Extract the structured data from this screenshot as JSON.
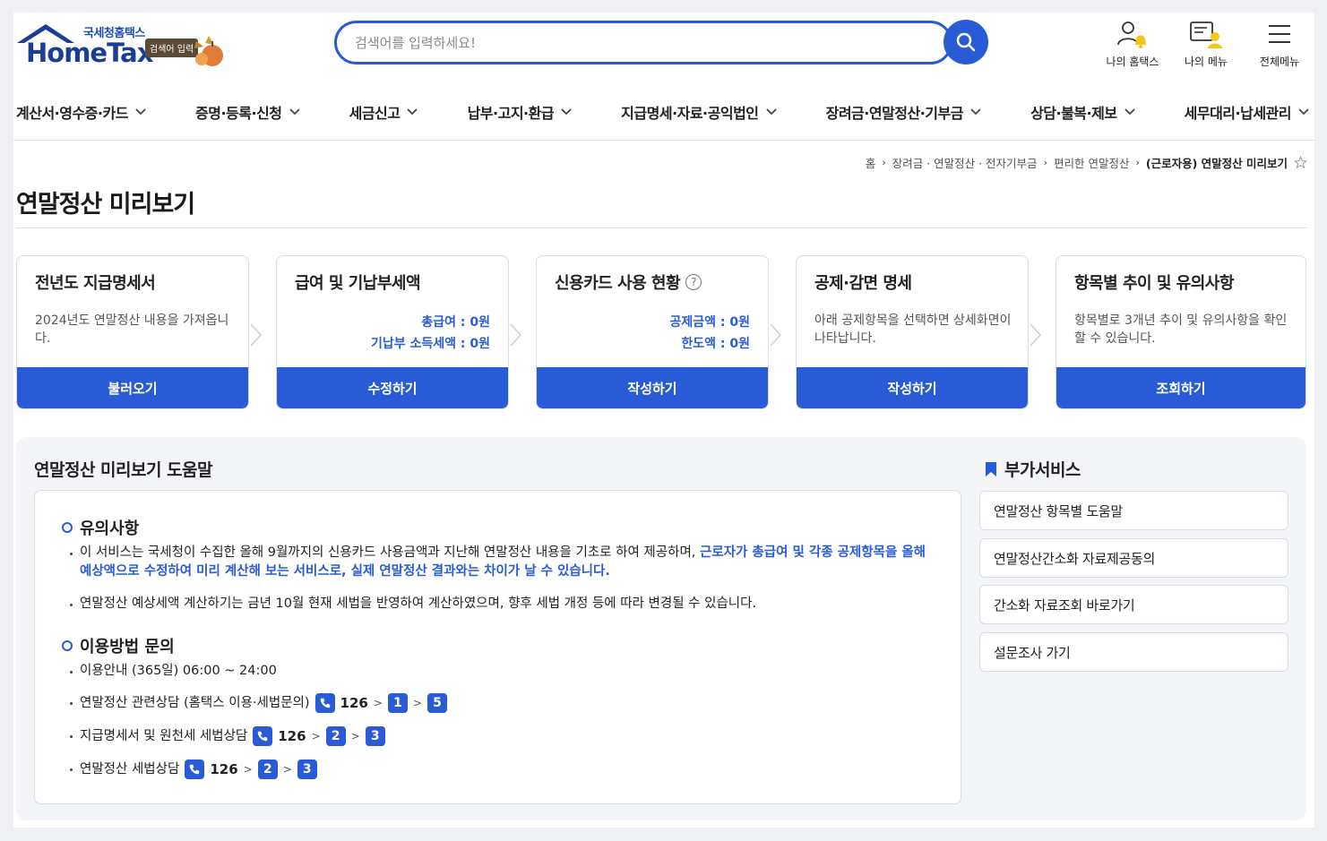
{
  "header": {
    "logo_sub": "국세청홈택스",
    "logo_main": "HomeTax",
    "logo_badge": "검색어 입력",
    "search_placeholder": "검색어를 입력하세요!",
    "links": [
      {
        "label": "나의 홈택스",
        "icon": "user-bell-icon"
      },
      {
        "label": "나의 메뉴",
        "icon": "my-menu-icon"
      },
      {
        "label": "전체메뉴",
        "icon": "hamburger-icon"
      }
    ]
  },
  "gnb": [
    "계산서·영수증·카드",
    "증명·등록·신청",
    "세금신고",
    "납부·고지·환급",
    "지급명세·자료·공익법인",
    "장려금·연말정산·기부금",
    "상담·불복·제보",
    "세무대리·납세관리"
  ],
  "breadcrumb": {
    "home": "홈",
    "items": [
      "장려금 · 연말정산 · 전자기부금",
      "편리한 연말정산"
    ],
    "current": "(근로자용) 연말정산 미리보기"
  },
  "page_title": "연말정산 미리보기",
  "cards": [
    {
      "title": "전년도 지급명세서",
      "desc": "2024년도 연말정산 내용을 가져옵니다.",
      "button": "불러오기"
    },
    {
      "title": "급여 및 기납부세액",
      "values": [
        "총급여 : 0원",
        "기납부 소득세액 : 0원"
      ],
      "button": "수정하기"
    },
    {
      "title": "신용카드 사용 현황",
      "values": [
        "공제금액 : 0원",
        "한도액 : 0원"
      ],
      "button": "작성하기",
      "help": "?"
    },
    {
      "title": "공제·감면 명세",
      "desc": "아래 공제항목을 선택하면 상세화면이 나타납니다.",
      "button": "작성하기"
    },
    {
      "title": "항목별 추이 및 유의사항",
      "desc": "항목별로 3개년 추이 및 유의사항을 확인할 수 있습니다.",
      "button": "조회하기"
    }
  ],
  "help": {
    "title": "연말정산 미리보기 도움말",
    "notice_title": "유의사항",
    "notice_1_plain": "이 서비스는 국세청이 수집한 올해 9월까지의 신용카드 사용금액과 지난해 연말정산 내용을 기초로 하여 제공하며, ",
    "notice_1_strong": "근로자가 총급여 및 각종 공제항목을 올해 예상액으로 수정하여 미리 계산해 보는 서비스로, 실제 연말정산 결과와는 차이가 날 수 있습니다.",
    "notice_2": "연말정산 예상세액 계산하기는 금년 10월 현재 세법을 반영하여 계산하였으며, 향후 세법 개정 등에 따라 변경될 수 있습니다.",
    "inquiry_title": "이용방법 문의",
    "inquiry_hours": "이용안내 (365일) 06:00 ~ 24:00",
    "phones": [
      {
        "label": "연말정산 관련상담 (홈택스 이용·세법문의)",
        "number": "126",
        "keys": [
          "1",
          "5"
        ]
      },
      {
        "label": "지급명세서 및 원천세 세법상담",
        "number": "126",
        "keys": [
          "2",
          "3"
        ]
      },
      {
        "label": "연말정산 세법상담",
        "number": "126",
        "keys": [
          "2",
          "3"
        ]
      }
    ]
  },
  "extra": {
    "title": "부가서비스",
    "items": [
      "연말정산 항목별 도움말",
      "연말정산간소화 자료제공동의",
      "간소화 자료조회 바로가기",
      "설문조사 가기"
    ]
  },
  "colors": {
    "primary": "#2a5bd7",
    "logo_navy": "#1b3d93"
  }
}
